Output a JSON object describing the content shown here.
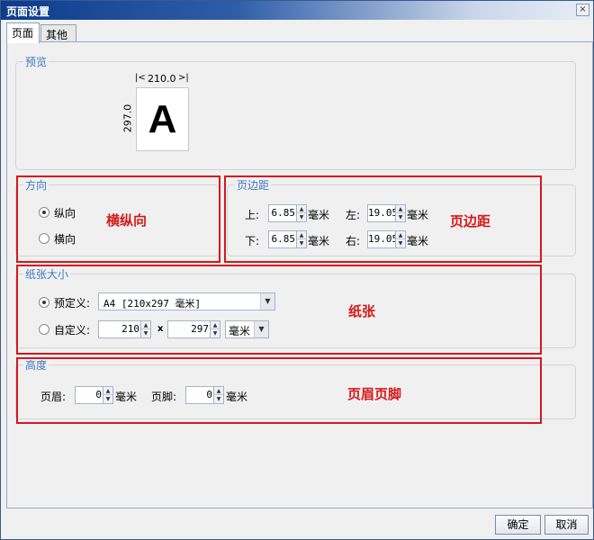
{
  "window": {
    "title": "页面设置",
    "close_glyph": "×"
  },
  "tabs": [
    {
      "label": "页面"
    },
    {
      "label": "其他"
    }
  ],
  "preview": {
    "legend": "预览",
    "width_label": "210.0",
    "height_label": "297.0",
    "sample_letter": "A"
  },
  "orientation": {
    "legend": "方向",
    "options": [
      {
        "label": "纵向",
        "selected": true
      },
      {
        "label": "横向",
        "selected": false
      }
    ],
    "annotation": "横纵向"
  },
  "margins": {
    "legend": "页边距",
    "top_label": "上:",
    "top_value": "6.85",
    "top_unit": "毫米",
    "left_label": "左:",
    "left_value": "19.05",
    "left_unit": "毫米",
    "bottom_label": "下:",
    "bottom_value": "6.85",
    "bottom_unit": "毫米",
    "right_label": "右:",
    "right_value": "19.05",
    "right_unit": "毫米",
    "annotation": "页边距"
  },
  "paper": {
    "legend": "纸张大小",
    "predefined_label": "预定义:",
    "predefined_selected": true,
    "predefined_value": "A4 [210x297 毫米]",
    "custom_label": "自定义:",
    "custom_selected": false,
    "custom_width": "210",
    "times": "x",
    "custom_height": "297",
    "custom_unit": "毫米",
    "annotation": "纸张"
  },
  "header_footer": {
    "legend": "高度",
    "header_label": "页眉:",
    "header_value": "0",
    "header_unit": "毫米",
    "footer_label": "页脚:",
    "footer_value": "0",
    "footer_unit": "毫米",
    "annotation": "页眉页脚"
  },
  "buttons": {
    "ok": "确定",
    "cancel": "取消"
  },
  "colors": {
    "annotation_red": "#d6161e",
    "legend_blue": "#3a7ac0",
    "title_blue": "#0e3c8c"
  }
}
